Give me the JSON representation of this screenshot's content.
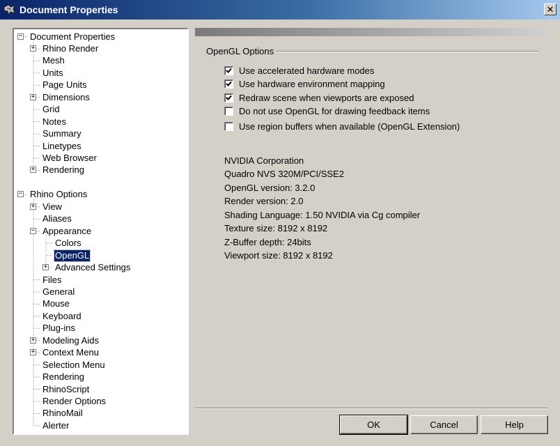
{
  "window": {
    "title": "Document Properties",
    "close_symbol": "✕"
  },
  "tree": {
    "items": [
      {
        "label": "Document Properties",
        "level": 0,
        "toggle": "minus"
      },
      {
        "label": "Rhino Render",
        "level": 1,
        "toggle": "plus"
      },
      {
        "label": "Mesh",
        "level": 1,
        "toggle": null
      },
      {
        "label": "Units",
        "level": 1,
        "toggle": null
      },
      {
        "label": "Page Units",
        "level": 1,
        "toggle": null
      },
      {
        "label": "Dimensions",
        "level": 1,
        "toggle": "plus"
      },
      {
        "label": "Grid",
        "level": 1,
        "toggle": null
      },
      {
        "label": "Notes",
        "level": 1,
        "toggle": null
      },
      {
        "label": "Summary",
        "level": 1,
        "toggle": null
      },
      {
        "label": "Linetypes",
        "level": 1,
        "toggle": null
      },
      {
        "label": "Web Browser",
        "level": 1,
        "toggle": null
      },
      {
        "label": "Rendering",
        "level": 1,
        "toggle": "plus"
      },
      {
        "label": "Rhino Options",
        "level": 0,
        "toggle": "minus"
      },
      {
        "label": "View",
        "level": 1,
        "toggle": "plus"
      },
      {
        "label": "Aliases",
        "level": 1,
        "toggle": null
      },
      {
        "label": "Appearance",
        "level": 1,
        "toggle": "minus"
      },
      {
        "label": "Colors",
        "level": 2,
        "toggle": null
      },
      {
        "label": "OpenGL",
        "level": 2,
        "toggle": null,
        "selected": true
      },
      {
        "label": "Advanced Settings",
        "level": 2,
        "toggle": "plus"
      },
      {
        "label": "Files",
        "level": 1,
        "toggle": null
      },
      {
        "label": "General",
        "level": 1,
        "toggle": null
      },
      {
        "label": "Mouse",
        "level": 1,
        "toggle": null
      },
      {
        "label": "Keyboard",
        "level": 1,
        "toggle": null
      },
      {
        "label": "Plug-ins",
        "level": 1,
        "toggle": null
      },
      {
        "label": "Modeling Aids",
        "level": 1,
        "toggle": "plus"
      },
      {
        "label": "Context Menu",
        "level": 1,
        "toggle": "plus"
      },
      {
        "label": "Selection Menu",
        "level": 1,
        "toggle": null
      },
      {
        "label": "Rendering",
        "level": 1,
        "toggle": null
      },
      {
        "label": "RhinoScript",
        "level": 1,
        "toggle": null
      },
      {
        "label": "Render Options",
        "level": 1,
        "toggle": null
      },
      {
        "label": "RhinoMail",
        "level": 1,
        "toggle": null
      },
      {
        "label": "Alerter",
        "level": 1,
        "toggle": null
      }
    ]
  },
  "opengl": {
    "group_title": "OpenGL Options",
    "options": [
      {
        "label": "Use accelerated hardware modes",
        "checked": true
      },
      {
        "label": "Use hardware environment mapping",
        "checked": true
      },
      {
        "label": "Redraw scene when viewports are exposed",
        "checked": true
      },
      {
        "label": "Do not use OpenGL for drawing feedback items",
        "checked": false
      },
      {
        "label": "Use region buffers when available (OpenGL Extension)",
        "checked": false
      }
    ],
    "info": {
      "vendor": "NVIDIA Corporation",
      "renderer": "Quadro NVS 320M/PCI/SSE2",
      "opengl_version": "OpenGL version: 3.2.0",
      "render_version": "Render version: 2.0",
      "shading_language": "Shading Language: 1.50 NVIDIA via Cg compiler",
      "texture_size": "Texture size: 8192 x 8192",
      "zbuffer_depth": "Z-Buffer depth: 24bits",
      "viewport_size": "Viewport size: 8192 x 8192"
    }
  },
  "buttons": {
    "ok": "OK",
    "cancel": "Cancel",
    "help": "Help"
  }
}
